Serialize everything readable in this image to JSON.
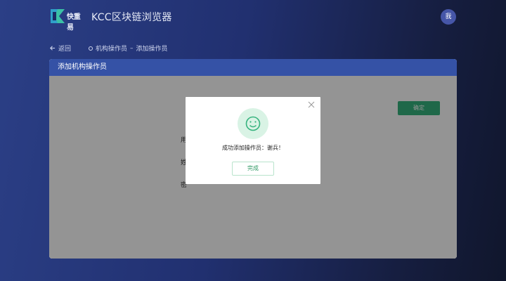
{
  "header": {
    "logo_text": "快重易",
    "app_title": "KCC区块链浏览器",
    "avatar_text": "我"
  },
  "breadcrumb": {
    "back_label": "返回",
    "parent": "机构操作员",
    "separator": "–",
    "current": "添加操作员"
  },
  "card": {
    "title": "添加机构操作员",
    "confirm_label": "确定",
    "field_labels": [
      "用",
      "姓",
      "密"
    ]
  },
  "dialog": {
    "message": "成功添加操作员：谢兵！",
    "done_label": "完成"
  },
  "colors": {
    "accent_blue": "#3552a6",
    "success_green": "#36b37e",
    "smile_bg": "#d9f3e5"
  }
}
